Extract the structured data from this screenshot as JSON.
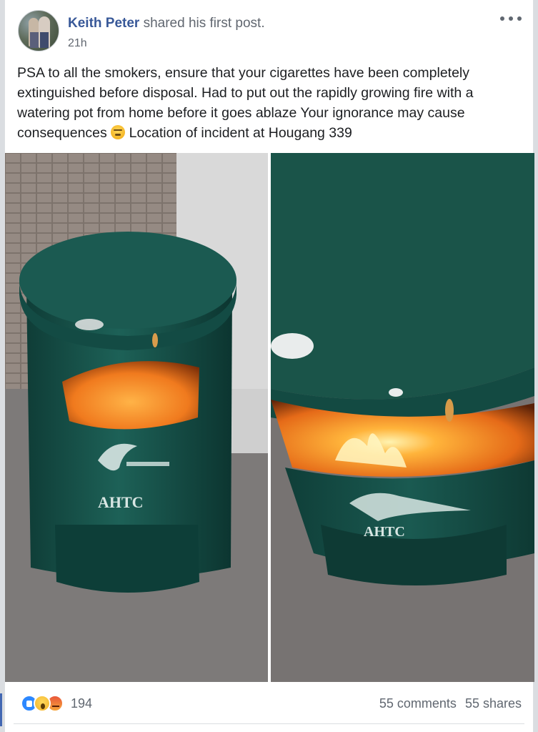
{
  "post": {
    "author": "Keith Peter",
    "action": " shared his first post.",
    "timestamp": "21h",
    "text_part1": "PSA to all the smokers, ensure that your cigarettes have been completely extinguished before disposal. Had to put out the rapidly growing fire with a watering pot from home before it goes ablaze Your ignorance may cause consequences ",
    "text_part2": " Location of incident at Hougang 339",
    "emoji": "tired-face-emoji",
    "photos": [
      {
        "id": "photo-left",
        "bin_label": "AHTC"
      },
      {
        "id": "photo-right",
        "bin_label": "AHTC"
      }
    ],
    "reactions": {
      "icons": [
        "like-icon",
        "wow-icon",
        "angry-icon"
      ],
      "count": "194"
    },
    "comments": "55 comments",
    "shares": "55 shares"
  },
  "colors": {
    "author": "#385898",
    "bin_green": "#17524a",
    "fire": "#f07a1e",
    "like_blue": "#2d88ff"
  }
}
